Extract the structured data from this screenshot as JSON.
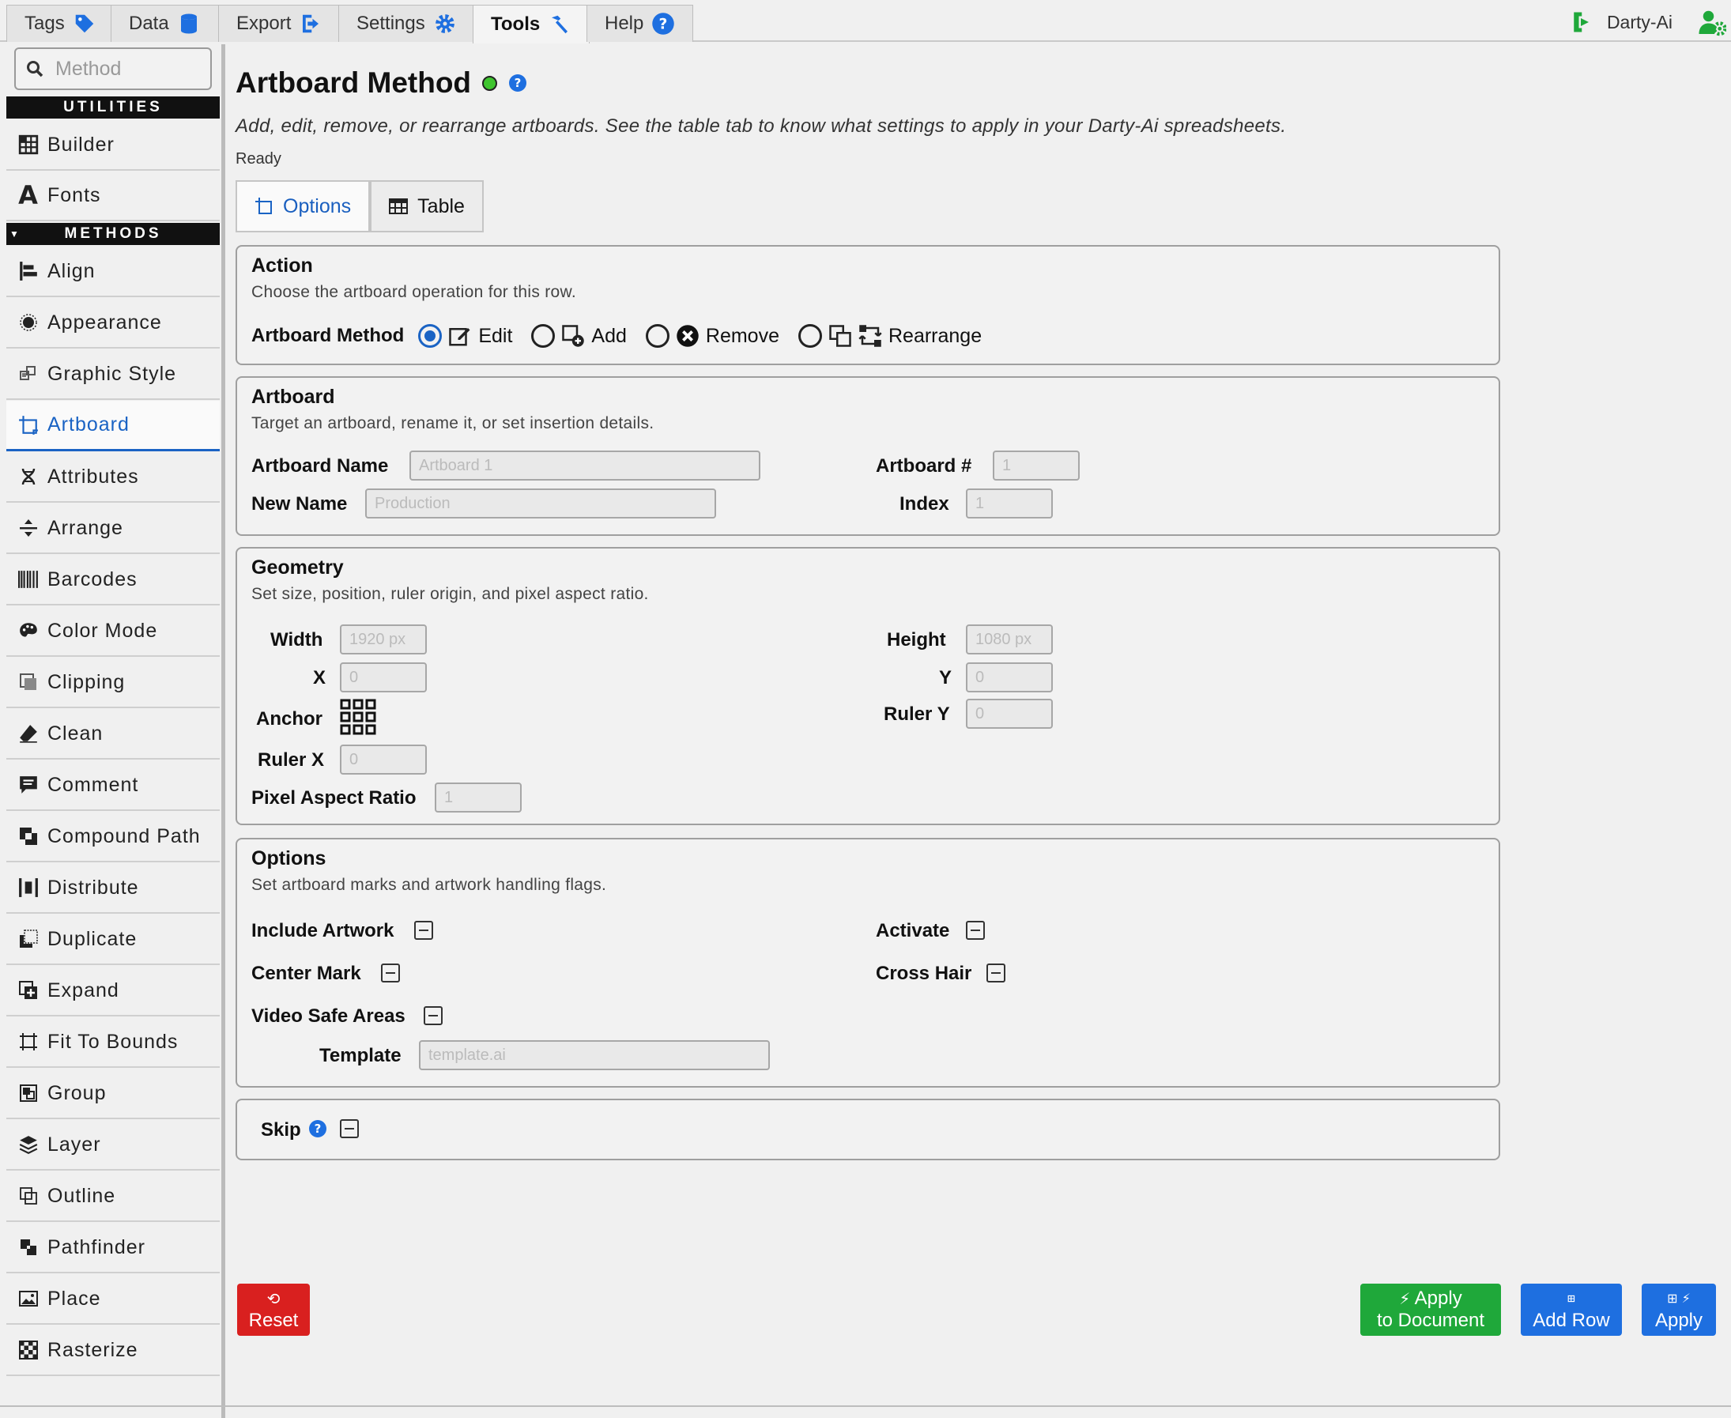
{
  "tabs": [
    {
      "label": "Tags"
    },
    {
      "label": "Data"
    },
    {
      "label": "Export"
    },
    {
      "label": "Settings"
    },
    {
      "label": "Tools"
    },
    {
      "label": "Help"
    }
  ],
  "user": {
    "name": "Darty-Ai"
  },
  "sidebar": {
    "search_placeholder": "Method",
    "utilities_header": "UTILITIES",
    "methods_header": "METHODS",
    "utilities": [
      {
        "label": "Builder"
      },
      {
        "label": "Fonts"
      }
    ],
    "methods": [
      {
        "label": "Align"
      },
      {
        "label": "Appearance"
      },
      {
        "label": "Graphic Style"
      },
      {
        "label": "Artboard"
      },
      {
        "label": "Attributes"
      },
      {
        "label": "Arrange"
      },
      {
        "label": "Barcodes"
      },
      {
        "label": "Color Mode"
      },
      {
        "label": "Clipping"
      },
      {
        "label": "Clean"
      },
      {
        "label": "Comment"
      },
      {
        "label": "Compound Path"
      },
      {
        "label": "Distribute"
      },
      {
        "label": "Duplicate"
      },
      {
        "label": "Expand"
      },
      {
        "label": "Fit To Bounds"
      },
      {
        "label": "Group"
      },
      {
        "label": "Layer"
      },
      {
        "label": "Outline"
      },
      {
        "label": "Pathfinder"
      },
      {
        "label": "Place"
      },
      {
        "label": "Rasterize"
      }
    ]
  },
  "page": {
    "title": "Artboard Method",
    "description": "Add, edit, remove, or rearrange artboards. See the table tab to know what settings to apply in your Darty-Ai spreadsheets.",
    "status": "Ready",
    "subtabs": {
      "options": "Options",
      "table": "Table"
    }
  },
  "action": {
    "title": "Action",
    "desc": "Choose the artboard operation for this row.",
    "label": "Artboard Method",
    "options": {
      "edit": "Edit",
      "add": "Add",
      "remove": "Remove",
      "rearrange": "Rearrange"
    }
  },
  "artboard": {
    "title": "Artboard",
    "desc": "Target an artboard, rename it, or set insertion details.",
    "name_label": "Artboard Name",
    "name_ph": "Artboard 1",
    "newname_label": "New Name",
    "newname_ph": "Production",
    "num_label": "Artboard #",
    "num_ph": "1",
    "index_label": "Index",
    "index_ph": "1"
  },
  "geometry": {
    "title": "Geometry",
    "desc": "Set size, position, ruler origin, and pixel aspect ratio.",
    "width_label": "Width",
    "width_ph": "1920 px",
    "x_label": "X",
    "x_ph": "0",
    "anchor_label": "Anchor",
    "rulerx_label": "Ruler X",
    "rulerx_ph": "0",
    "par_label": "Pixel Aspect Ratio",
    "par_ph": "1",
    "height_label": "Height",
    "height_ph": "1080 px",
    "y_label": "Y",
    "y_ph": "0",
    "rulery_label": "Ruler Y",
    "rulery_ph": "0"
  },
  "options": {
    "title": "Options",
    "desc": "Set artboard marks and artwork handling flags.",
    "include": "Include Artwork",
    "center": "Center Mark",
    "video": "Video Safe Areas",
    "activate": "Activate",
    "crosshair": "Cross Hair",
    "template_label": "Template",
    "template_ph": "template.ai"
  },
  "skip": {
    "label": "Skip"
  },
  "buttons": {
    "reset": "Reset",
    "apply_doc_1": "Apply",
    "apply_doc_2": "to Document",
    "add_row": "Add Row",
    "apply": "Apply"
  },
  "colors": {
    "accent": "#1a63c4",
    "reset": "#d9201f",
    "green": "#1fa83a",
    "blue": "#1e6fe0"
  }
}
